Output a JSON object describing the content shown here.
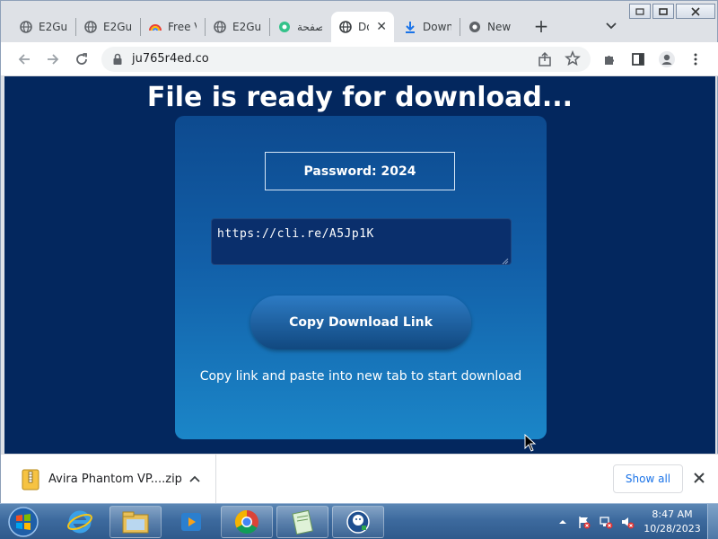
{
  "window": {
    "controls": {
      "minimize": "▭",
      "maximize": "□",
      "close": "✕"
    }
  },
  "tabs": [
    {
      "title": "E2Gu",
      "icon": "globe-icon"
    },
    {
      "title": "E2Gu",
      "icon": "globe-icon"
    },
    {
      "title": "Free V",
      "icon": "rainbow-icon"
    },
    {
      "title": "E2Gu",
      "icon": "globe-icon"
    },
    {
      "title": "صفحة",
      "icon": "green-circle-icon"
    },
    {
      "title": "Do",
      "icon": "globe-icon",
      "active": true
    },
    {
      "title": "Down",
      "icon": "download-icon"
    },
    {
      "title": "New",
      "icon": "chrome-icon"
    }
  ],
  "toolbar": {
    "url": "ju765r4ed.co"
  },
  "page": {
    "heading": "File is ready for download...",
    "password_label": "Password: 2024",
    "link_value": "https://cli.re/A5Jp1K",
    "copy_button": "Copy Download Link",
    "hint": "Copy link and paste into new tab to start download"
  },
  "download_shelf": {
    "file_name": "Avira Phantom VP....zip",
    "show_all": "Show all"
  },
  "taskbar": {
    "apps": [
      "internet-explorer",
      "file-explorer",
      "media-player",
      "chrome",
      "notepad",
      "vpn"
    ],
    "time": "8:47 AM",
    "date": "10/28/2023"
  },
  "colors": {
    "page_bg": "#03275e",
    "card_top": "#0d4a8f",
    "card_bottom": "#1b86c8",
    "link_blue": "#1a73e8"
  }
}
